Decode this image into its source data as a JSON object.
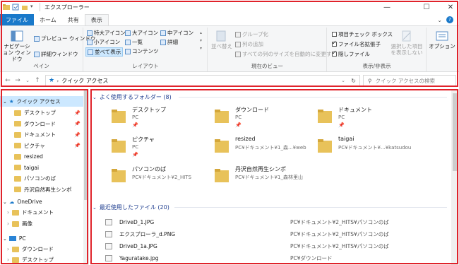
{
  "window": {
    "title": "エクスプローラー"
  },
  "tabs": [
    "ファイル",
    "ホーム",
    "共有",
    "表示"
  ],
  "ribbon": {
    "pane_group": {
      "label": "ペイン",
      "nav_pane": "ナビゲーション ウィンドウ",
      "preview": "プレビュー ウィンドウ",
      "details": "詳細ウィンドウ"
    },
    "layout_group": {
      "label": "レイアウト",
      "items": [
        "特大アイコン",
        "大アイコン",
        "中アイコン",
        "小アイコン",
        "一覧",
        "詳細",
        "並べて表示",
        "コンテンツ"
      ],
      "selected": "並べて表示"
    },
    "current_view": {
      "label": "現在のビュー",
      "sort": "並べ替え",
      "group_by": "グループ化",
      "add_column": "列の追加",
      "size_all": "すべての列のサイズを自動的に変更する"
    },
    "show_hide": {
      "label": "表示/非表示",
      "item_checkbox": "項目チェック ボックス",
      "extensions": "ファイル名拡張子",
      "hidden": "隠しファイル",
      "hide_selected": "選択した項目を表示しない",
      "options": "オプション"
    }
  },
  "address": {
    "path": "クイック アクセス",
    "search_placeholder": "クイック アクセスの検索"
  },
  "nav": {
    "quick_access": "クイック アクセス",
    "qa_items": [
      {
        "label": "デスクトップ",
        "pinned": true
      },
      {
        "label": "ダウンロード",
        "pinned": true
      },
      {
        "label": "ドキュメント",
        "pinned": true
      },
      {
        "label": "ピクチャ",
        "pinned": true
      },
      {
        "label": "resized",
        "pinned": false
      },
      {
        "label": "taigai",
        "pinned": false
      },
      {
        "label": "パソコンのば",
        "pinned": false
      },
      {
        "label": "丹沢自然再生シンポ",
        "pinned": false
      }
    ],
    "onedrive": "OneDrive",
    "onedrive_items": [
      "ドキュメント",
      "画像"
    ],
    "pc": "PC",
    "pc_items": [
      "ダウンロード",
      "デスクトップ"
    ]
  },
  "content": {
    "frequent_header": "よく使用するフォルダー (8)",
    "folders": [
      {
        "name": "デスクトップ",
        "location": "PC",
        "pinned": true
      },
      {
        "name": "ダウンロード",
        "location": "PC",
        "pinned": true
      },
      {
        "name": "ドキュメント",
        "location": "PC",
        "pinned": true
      },
      {
        "name": "ピクチャ",
        "location": "PC",
        "pinned": true
      },
      {
        "name": "resized",
        "location": "PC¥ドキュメント¥1_森...¥web",
        "pinned": false
      },
      {
        "name": "taigai",
        "location": "PC¥ドキュメント¥...¥katsudou",
        "pinned": false
      },
      {
        "name": "パソコンのば",
        "location": "PC¥ドキュメント¥2_HITS",
        "pinned": false
      },
      {
        "name": "丹沢自然再生シンポ",
        "location": "PC¥ドキュメント¥1_森林里山",
        "pinned": false
      }
    ],
    "recent_header": "最近使用したファイル (20)",
    "files": [
      {
        "name": "DriveD_1.JPG",
        "path": "PC¥ドキュメント¥2_HITS¥パソコンのば"
      },
      {
        "name": "エクスプローラ_d.PNG",
        "path": "PC¥ドキュメント¥2_HITS¥パソコンのば"
      },
      {
        "name": "DriveD_1a.JPG",
        "path": "PC¥ドキュメント¥2_HITS¥パソコンのば"
      },
      {
        "name": "Yaguratake.jpg",
        "path": "PC¥ダウンロード"
      }
    ]
  },
  "colors": {
    "accent": "#1979ca",
    "outline": "#e0232b",
    "folder": "#e8c25a",
    "selected": "#cce8ff"
  }
}
